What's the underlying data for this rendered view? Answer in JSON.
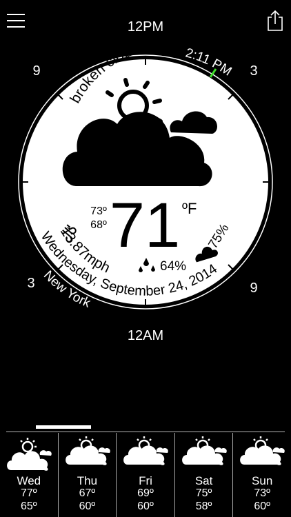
{
  "header": {
    "top_label": "12PM",
    "bottom_label": "12AM"
  },
  "dial": {
    "hour_left_top": "9",
    "hour_right_top": "3",
    "hour_left_bottom": "3",
    "hour_right_bottom": "9",
    "time": "2:11 PM",
    "condition": "broken clouds",
    "temperature": "71",
    "unit": "ºF",
    "high": "73º",
    "low": "68º",
    "wind": "13.87mph",
    "humidity": "64%",
    "cloudiness": "75%",
    "date": "Wednesday, September 24, 2014",
    "city": "New York",
    "accent_color": "#3ddc2a"
  },
  "forecast": [
    {
      "day": "Wed",
      "high": "77º",
      "low": "65º",
      "icon": "cloud-sun-icon"
    },
    {
      "day": "Thu",
      "high": "67º",
      "low": "60º",
      "icon": "cloud-rain-sun-icon"
    },
    {
      "day": "Fri",
      "high": "69º",
      "low": "60º",
      "icon": "cloud-rain-sun-icon"
    },
    {
      "day": "Sat",
      "high": "75º",
      "low": "58º",
      "icon": "cloud-rain-sun-icon"
    },
    {
      "day": "Sun",
      "high": "73º",
      "low": "60º",
      "icon": "cloud-rain-sun-icon"
    }
  ]
}
